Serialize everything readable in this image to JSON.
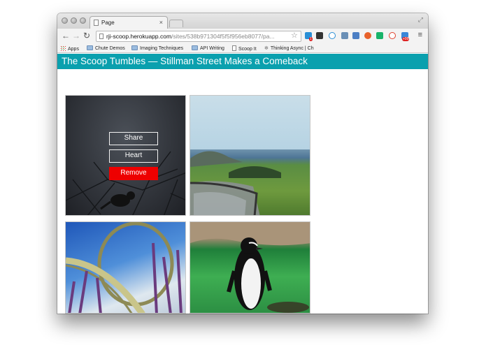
{
  "browser": {
    "tab_title": "Page",
    "tab_close": "×",
    "url_host": "rji-scoop.herokuapp.com",
    "url_path": "/sites/538b971304f5f5f956eb8077/pa...",
    "badge_1": "1",
    "badge_99": "+99",
    "bookmarks": [
      {
        "label": "Apps",
        "icon": "apps-grid-icon"
      },
      {
        "label": "Chute Demos",
        "icon": "folder-icon"
      },
      {
        "label": "Imaging Techniques",
        "icon": "folder-icon"
      },
      {
        "label": "API Writing",
        "icon": "folder-icon"
      },
      {
        "label": "Scoop It",
        "icon": "page-icon"
      },
      {
        "label": "Thinking Async | Ch",
        "icon": "gear-icon"
      }
    ]
  },
  "page": {
    "title": "The Scoop Tumbles — Stillman Street Makes a Comeback",
    "overlay": {
      "share_label": "Share",
      "heart_label": "Heart",
      "remove_label": "Remove"
    }
  },
  "colors": {
    "header_bg": "#0aa0ae",
    "remove_button": "#ee0000"
  }
}
